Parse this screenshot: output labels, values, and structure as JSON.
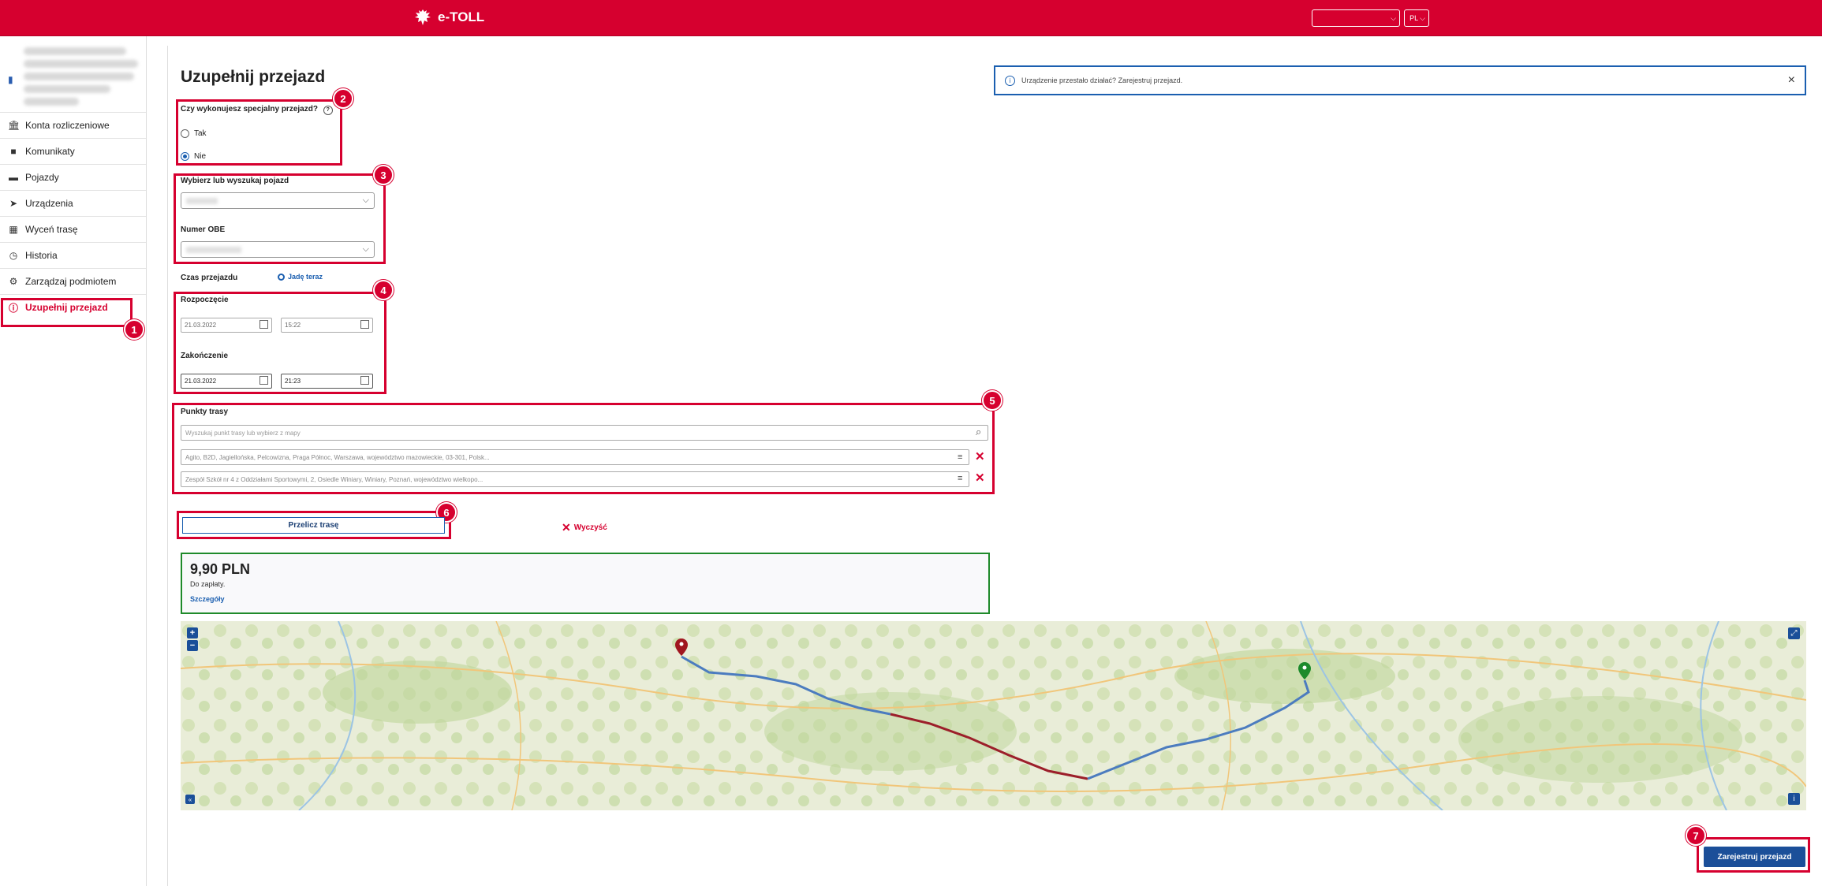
{
  "header": {
    "app_name": "e-TOLL",
    "language": "PL"
  },
  "sidebar": {
    "items": [
      {
        "label": "Konta rozliczeniowe",
        "icon": "bank-icon"
      },
      {
        "label": "Komunikaty",
        "icon": "message-icon"
      },
      {
        "label": "Pojazdy",
        "icon": "truck-icon"
      },
      {
        "label": "Urządzenia",
        "icon": "navigation-icon"
      },
      {
        "label": "Wyceń trasę",
        "icon": "calculator-icon"
      },
      {
        "label": "Historia",
        "icon": "clock-icon"
      },
      {
        "label": "Zarządzaj podmiotem",
        "icon": "gear-icon"
      },
      {
        "label": "Uzupełnij przejazd",
        "icon": "alert-circle-icon",
        "active": true
      }
    ]
  },
  "page": {
    "title": "Uzupełnij przejazd",
    "info_banner": "Urządzenie przestało działać? Zarejestruj przejazd."
  },
  "special_trip": {
    "question": "Czy wykonujesz specjalny przejazd?",
    "options": [
      "Tak",
      "Nie"
    ],
    "selected": "Nie"
  },
  "vehicle": {
    "label": "Wybierz lub wyszukaj pojazd",
    "obe_label": "Numer OBE"
  },
  "time": {
    "label": "Czas przejazdu",
    "now_option": "Jadę teraz",
    "start_label": "Rozpoczęcie",
    "start_date": "21.03.2022",
    "start_time": "15:22",
    "end_label": "Zakończenie",
    "end_date": "21.03.2022",
    "end_time": "21:23"
  },
  "route": {
    "label": "Punkty trasy",
    "search_placeholder": "Wyszukaj punkt trasy lub wybierz z mapy",
    "points": [
      "Agito, B2D, Jagiellońska, Pelcowizna, Praga Północ, Warszawa, województwo mazowieckie, 03-301, Polsk...",
      "Zespół Szkół nr 4 z Oddziałami Sportowymi, 2, Osiedle Winiary, Winiary, Poznań, województwo wielkopo..."
    ]
  },
  "actions": {
    "recalc": "Przelicz trasę",
    "clear": "Wyczyść",
    "register": "Zarejestruj przejazd"
  },
  "price": {
    "amount": "9,90 PLN",
    "note": "Do zapłaty.",
    "details": "Szczegóły"
  },
  "annotations": [
    "1",
    "2",
    "3",
    "4",
    "5",
    "6",
    "7"
  ],
  "colors": {
    "brand_red": "#d6002f",
    "primary_blue": "#1b4f99",
    "success_green": "#1f8a2a"
  }
}
